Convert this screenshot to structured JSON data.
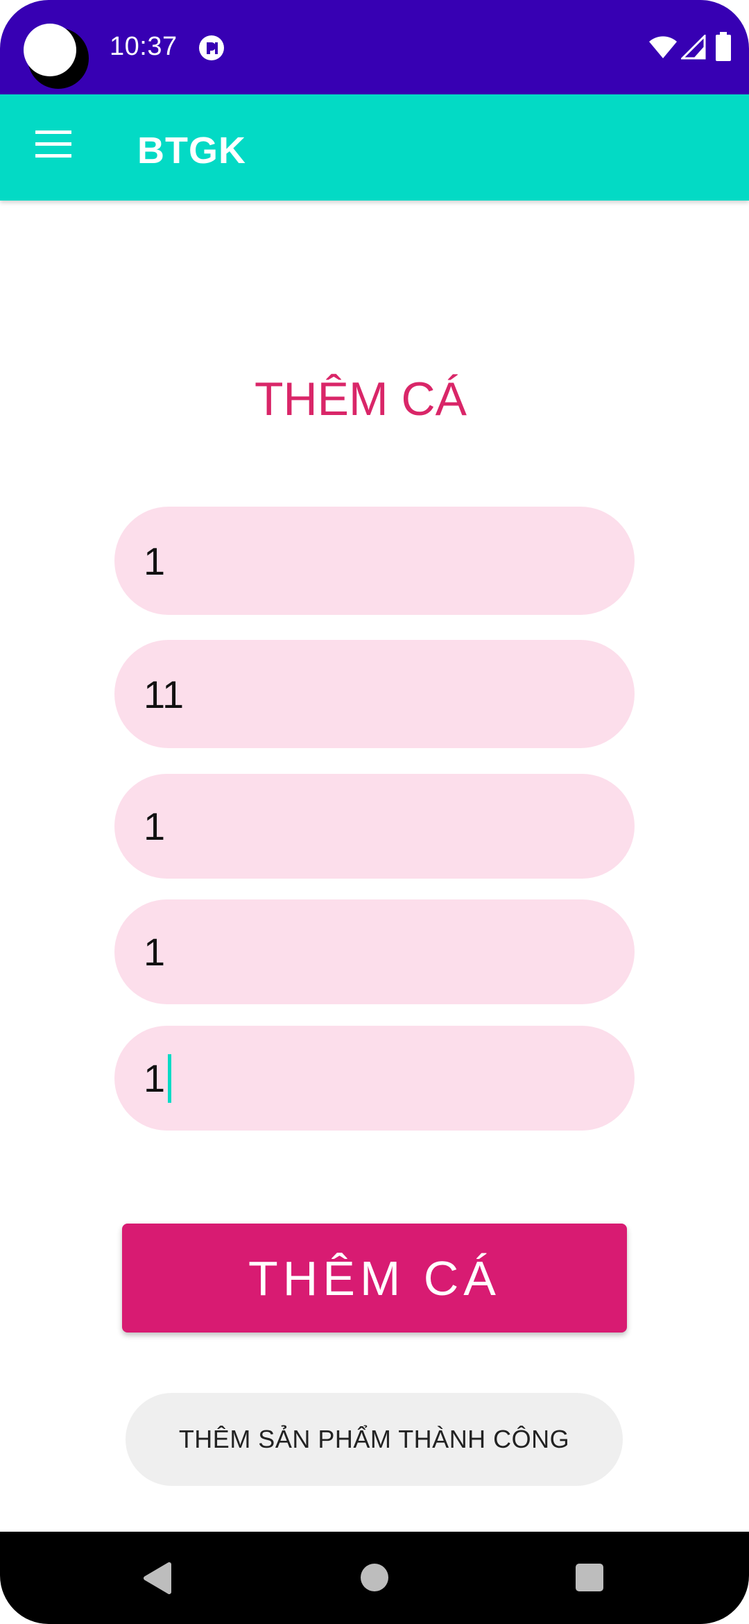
{
  "status_bar": {
    "time": "10:37",
    "icons": [
      "notification-icon",
      "wifi-icon",
      "signal-icon",
      "battery-icon"
    ]
  },
  "app_bar": {
    "title": "BTGK",
    "menu_icon": "menu-icon"
  },
  "form": {
    "heading": "THÊM CÁ",
    "fields": [
      {
        "value": "1"
      },
      {
        "value": "11"
      },
      {
        "value": "1"
      },
      {
        "value": "1"
      },
      {
        "value": "1"
      }
    ],
    "submit_label": "THÊM CÁ"
  },
  "toast": {
    "message": "THÊM SẢN PHẨM THÀNH CÔNG"
  },
  "nav_bar": {
    "icons": [
      "back-icon",
      "home-icon",
      "recents-icon"
    ]
  },
  "colors": {
    "status_bar": "#3700b3",
    "app_bar": "#03dac5",
    "accent": "#d81b60",
    "field_bg": "#fcdeeb",
    "toast_bg": "#efefef"
  }
}
